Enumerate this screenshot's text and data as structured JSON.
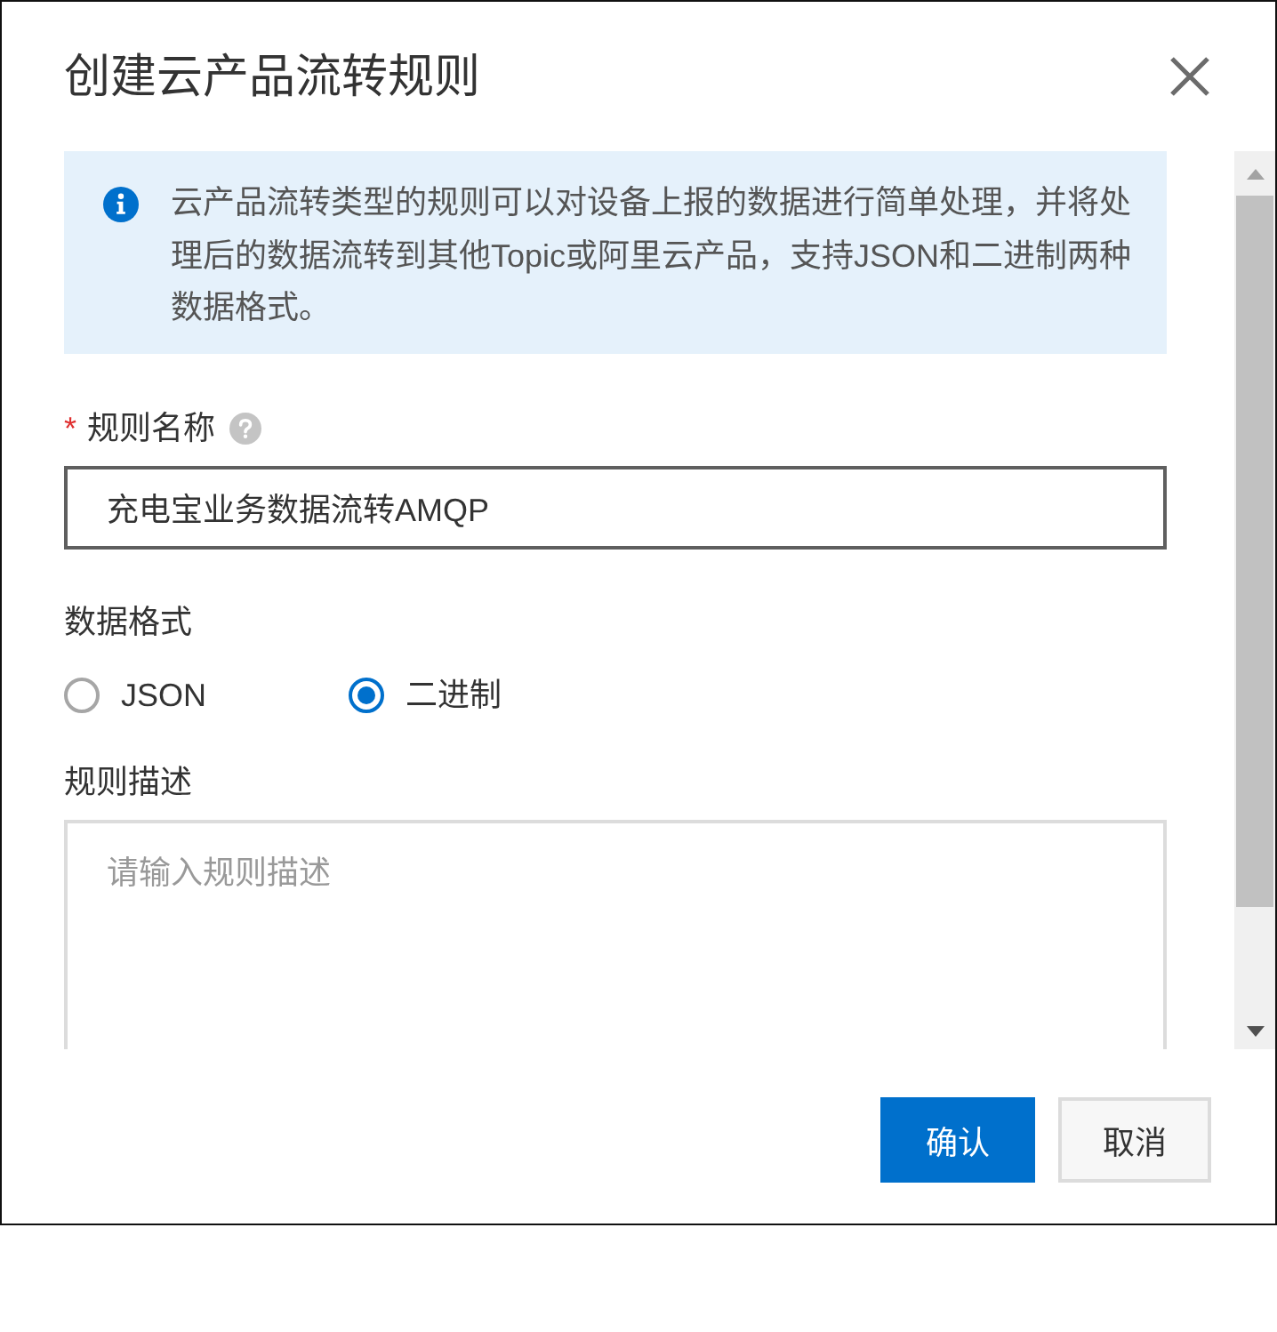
{
  "dialog": {
    "title": "创建云产品流转规则"
  },
  "notice": {
    "text": "云产品流转类型的规则可以对设备上报的数据进行简单处理，并将处理后的数据流转到其他Topic或阿里云产品，支持JSON和二进制两种数据格式。"
  },
  "fields": [
    {
      "kind": "text",
      "required_mark": "*",
      "label": "规则名称",
      "help": true,
      "value": "充电宝业务数据流转AMQP",
      "focused": true
    },
    {
      "kind": "radio",
      "label": "数据格式",
      "options": [
        {
          "label": "JSON",
          "selected": false
        },
        {
          "label": "二进制",
          "selected": true
        }
      ]
    },
    {
      "kind": "textarea",
      "label": "规则描述",
      "placeholder": "请输入规则描述"
    }
  ],
  "buttons": [
    {
      "label": "确认",
      "kind": "primary"
    },
    {
      "label": "取消",
      "kind": "secondary"
    }
  ]
}
